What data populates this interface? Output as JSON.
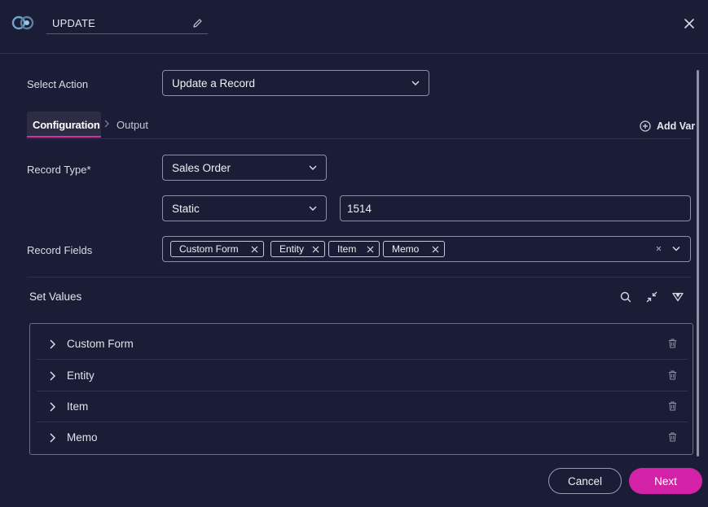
{
  "header": {
    "title": "UPDATE",
    "logo_icon": "app-logo-icon",
    "edit_icon": "pencil-icon",
    "close_icon": "close-icon"
  },
  "form": {
    "select_action": {
      "label": "Select Action",
      "value": "Update a Record"
    },
    "tabs": [
      {
        "label": "Configuration",
        "active": true
      },
      {
        "label": "Output",
        "active": false
      }
    ],
    "add_var_label": "Add Var",
    "record_type": {
      "label": "Record Type*",
      "value": "Sales Order"
    },
    "id_mode": {
      "value": "Static"
    },
    "id_value": {
      "value": "1514"
    },
    "record_fields": {
      "label": "Record Fields",
      "chips": [
        "Custom Form",
        "Entity",
        "Item",
        "Memo"
      ]
    }
  },
  "set_values": {
    "title": "Set Values",
    "tools": [
      "search-icon",
      "collapse-icon",
      "filter-icon"
    ],
    "rows": [
      {
        "label": "Custom Form"
      },
      {
        "label": "Entity"
      },
      {
        "label": "Item"
      },
      {
        "label": "Memo"
      }
    ]
  },
  "footer": {
    "cancel_label": "Cancel",
    "next_label": "Next"
  },
  "colors": {
    "background": "#1b1c35",
    "accent": "#d322a7",
    "border": "#8e8fa6",
    "divider": "#30324c"
  }
}
